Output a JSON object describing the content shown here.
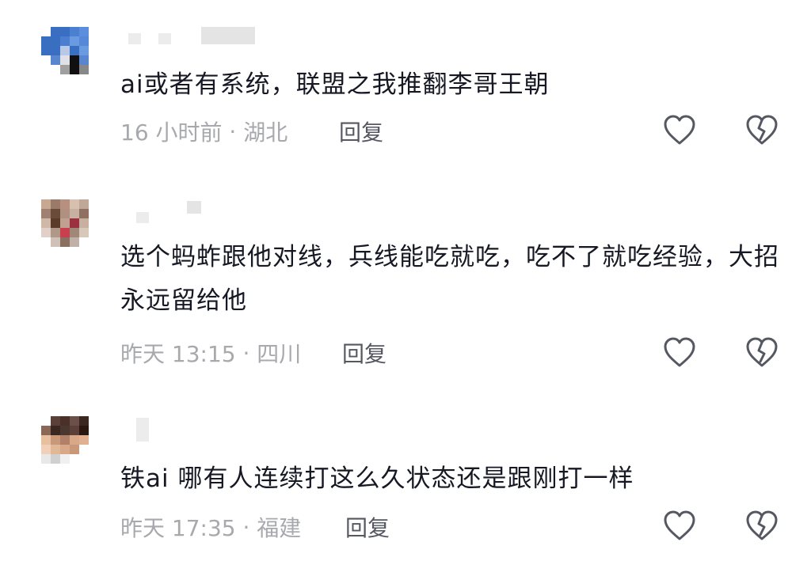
{
  "comments": [
    {
      "text": "ai或者有系统，联盟之我推翻李哥王朝",
      "time": "16 小时前",
      "location": "湖北",
      "reply_label": "回复",
      "avatar_colors": [
        "#ffffff",
        "#3a6ec0",
        "#3a6ec0",
        "#4b7fd0",
        "#5c8ee0",
        "#ffffff",
        "#ffffff",
        "#3a6ec0",
        "#3a6ec0",
        "#4a7ed0",
        "#6a9ae0",
        "#5588d8",
        "#ffffff",
        "#ffffff",
        "#3a6ec0",
        "#3a6ec0",
        "#b8c8e8",
        "#3a6ec0",
        "#6a9ae0",
        "#ffffff",
        "#ffffff",
        "#ffffff",
        "#5a86d0",
        "#e0e0e8",
        "#101010",
        "#5a86d0",
        "#ffffff",
        "#ffffff",
        "#ffffff",
        "#ffffff",
        "#a0a0a0",
        "#101010",
        "#888888",
        "#ffffff",
        "#ffffff",
        "#ffffff",
        "#ffffff",
        "#ffffff",
        "#ffffff",
        "#ffffff",
        "#ffffff",
        "#ffffff",
        "#ffffff",
        "#ffffff",
        "#ffffff",
        "#ffffff",
        "#ffffff",
        "#ffffff",
        "#ffffff"
      ]
    },
    {
      "text": "选个蚂蚱跟他对线，兵线能吃就吃，吃不了就吃经验，大招永远留给他",
      "time": "昨天 13:15",
      "location": "四川",
      "reply_label": "回复",
      "avatar_colors": [
        "#c8a890",
        "#9a7a68",
        "#b89080",
        "#d8c0b0",
        "#c0a898",
        "#ffffff",
        "#ffffff",
        "#a08070",
        "#6a4a38",
        "#b09080",
        "#c8b0a0",
        "#907060",
        "#ffffff",
        "#ffffff",
        "#d0b8a8",
        "#5a3a28",
        "#c0a090",
        "#9a3040",
        "#c8b0a0",
        "#ffffff",
        "#ffffff",
        "#e0d0c8",
        "#b09888",
        "#c84050",
        "#a08878",
        "#d8c8b8",
        "#ffffff",
        "#ffffff",
        "#ffffff",
        "#d0c0b8",
        "#8a7060",
        "#c0b0a8",
        "#ffffff",
        "#ffffff",
        "#ffffff",
        "#ffffff",
        "#ffffff",
        "#ffffff",
        "#ffffff",
        "#ffffff",
        "#ffffff",
        "#ffffff",
        "#ffffff",
        "#ffffff",
        "#ffffff",
        "#ffffff",
        "#ffffff",
        "#ffffff",
        "#ffffff"
      ]
    },
    {
      "text": "铁ai 哪有人连续打这么久状态还是跟刚打一样",
      "time": "昨天 17:35",
      "location": "福建",
      "reply_label": "回复",
      "avatar_colors": [
        "#ffffff",
        "#5a4038",
        "#4a3028",
        "#6a5048",
        "#3a2820",
        "#ffffff",
        "#ffffff",
        "#8a6858",
        "#3a2820",
        "#4a3830",
        "#5a4038",
        "#2a1810",
        "#ffffff",
        "#ffffff",
        "#e8c0a0",
        "#c89878",
        "#b08068",
        "#d8a888",
        "#e0b090",
        "#ffffff",
        "#ffffff",
        "#f0d0b8",
        "#e0b898",
        "#d8a888",
        "#c89878",
        "#ffffff",
        "#ffffff",
        "#ffffff",
        "#e8e8e8",
        "#d0d0d0",
        "#f0f0f0",
        "#ffffff",
        "#ffffff",
        "#ffffff",
        "#ffffff",
        "#ffffff",
        "#ffffff",
        "#ffffff",
        "#ffffff",
        "#ffffff",
        "#ffffff",
        "#ffffff",
        "#ffffff",
        "#ffffff",
        "#ffffff",
        "#ffffff",
        "#ffffff",
        "#ffffff",
        "#ffffff"
      ]
    }
  ]
}
